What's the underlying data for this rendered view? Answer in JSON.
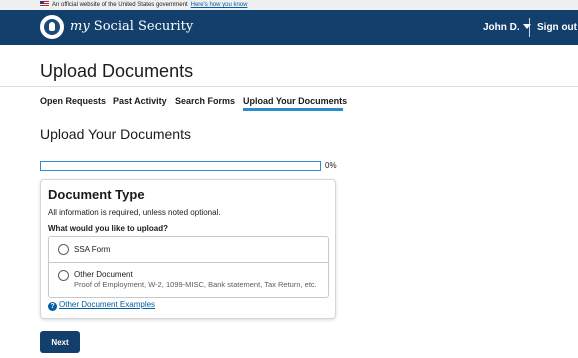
{
  "gov_banner": {
    "text": "An official website of the United States government",
    "link": "Here's how you know"
  },
  "header": {
    "brand_my": "my",
    "brand_rest": " Social Security",
    "user_name": "John D.",
    "signout_label": "Sign out"
  },
  "page": {
    "title": "Upload Documents"
  },
  "tabs": [
    {
      "label": "Open Requests"
    },
    {
      "label": "Past Activity"
    },
    {
      "label": "Search Forms"
    },
    {
      "label": "Upload Your Documents",
      "active": true
    }
  ],
  "section": {
    "title": "Upload Your Documents"
  },
  "progress": {
    "value": 0,
    "label": "0%"
  },
  "document_type": {
    "title": "Document Type",
    "note": "All information is required, unless noted optional.",
    "question": "What would you like to upload?",
    "options": [
      {
        "label": "SSA Form",
        "hint": "",
        "selected": false
      },
      {
        "label": "Other Document",
        "hint": "Proof of Employment, W-2, 1099-MISC, Bank statement, Tax Return, etc.",
        "selected": false
      }
    ],
    "examples_link": "Other Document Examples"
  },
  "actions": {
    "next_label": "Next"
  },
  "colors": {
    "header_bg": "#123f6b",
    "accent": "#2e8bc9",
    "link": "#005ea2"
  },
  "icons": [
    "us-flag-icon",
    "ssa-seal-icon",
    "caret-down-icon",
    "help-icon"
  ]
}
